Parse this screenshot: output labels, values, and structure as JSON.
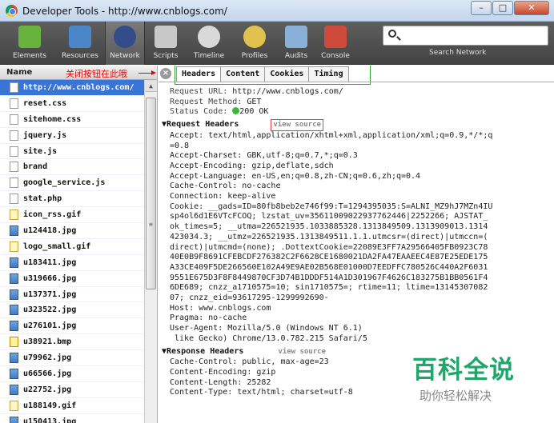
{
  "window": {
    "title": "Developer Tools - http://www.cnblogs.com/",
    "min_label": "–",
    "max_label": "□",
    "close_label": "✕"
  },
  "toolbar": {
    "tools": [
      {
        "label": "Elements",
        "color": "#68b33c"
      },
      {
        "label": "Resources",
        "color": "#4b86c9"
      },
      {
        "label": "Network",
        "color": "#334c8a"
      },
      {
        "label": "Scripts",
        "color": "#c8c8c8"
      },
      {
        "label": "Timeline",
        "color": "#d9d9d9"
      },
      {
        "label": "Profiles",
        "color": "#e2c24f"
      },
      {
        "label": "Audits",
        "color": "#8ab0d8"
      },
      {
        "label": "Console",
        "color": "#cf4a3b"
      }
    ],
    "search_label": "Search Network"
  },
  "left_pane": {
    "header": "Name",
    "annotation": "关闭按钮在此哦",
    "files": [
      {
        "name": "http://www.cnblogs.com/",
        "type": "doc"
      },
      {
        "name": "reset.css",
        "type": "doc"
      },
      {
        "name": "sitehome.css",
        "type": "doc"
      },
      {
        "name": "jquery.js",
        "type": "doc"
      },
      {
        "name": "site.js",
        "type": "doc"
      },
      {
        "name": "brand",
        "type": "doc"
      },
      {
        "name": "google_service.js",
        "type": "doc"
      },
      {
        "name": "stat.php",
        "type": "doc"
      },
      {
        "name": "icon_rss.gif",
        "type": "gif"
      },
      {
        "name": "u124418.jpg",
        "type": "img"
      },
      {
        "name": "logo_small.gif",
        "type": "gif"
      },
      {
        "name": "u183411.jpg",
        "type": "img"
      },
      {
        "name": "u319666.jpg",
        "type": "img"
      },
      {
        "name": "u137371.jpg",
        "type": "img"
      },
      {
        "name": "u323522.jpg",
        "type": "img"
      },
      {
        "name": "u276101.jpg",
        "type": "img"
      },
      {
        "name": "u38921.bmp",
        "type": "bmp"
      },
      {
        "name": "u79962.jpg",
        "type": "img"
      },
      {
        "name": "u66566.jpg",
        "type": "img"
      },
      {
        "name": "u22752.jpg",
        "type": "img"
      },
      {
        "name": "u188149.gif",
        "type": "gif"
      },
      {
        "name": "u150413.jpg",
        "type": "img"
      }
    ]
  },
  "right_pane": {
    "close_label": "×",
    "tabs": [
      "Headers",
      "Content",
      "Cookies",
      "Timing"
    ],
    "request_url": {
      "key": "Request URL:",
      "value": "http://www.cnblogs.com/"
    },
    "request_method": {
      "key": "Request Method:",
      "value": "GET"
    },
    "status_code": {
      "key": "Status Code:",
      "value": "200 OK"
    },
    "request_headers_title": "Request Headers",
    "view_source": "view source",
    "request_headers": [
      "Accept: text/html,application/xhtml+xml,application/xml;q=0.9,*/*;q",
      "=0.8",
      "Accept-Charset: GBK,utf-8;q=0.7,*;q=0.3",
      "Accept-Encoding: gzip,deflate,sdch",
      "Accept-Language: en-US,en;q=0.8,zh-CN;q=0.6,zh;q=0.4",
      "Cache-Control: no-cache",
      "Connection: keep-alive",
      "Cookie: __gads=ID=80fb8beb2e746f99:T=1294395035:S=ALNI_MZ9hJ7MZn4IU",
      "sp4ol6d1E6VTcFCOQ; lzstat_uv=35611009022937762446|2252266; AJSTAT_",
      "ok_times=5; __utma=226521935.1033885328.1313849509.1313909013.1314",
      "423034.3; __utmz=226521935.1313849511.1.1.utmcsr=(direct)|utmccn=(",
      "direct)|utmcmd=(none); .DottextCookie=22089E3FF7A29566405FB0923C78",
      "40E0B9F8691CFEBCDF276382C2F6628CE1680021DA2FA47EAAEEC4E87E25EDE175",
      "A33CE409F5DE266560E102A49E9AE02B568E01000D7EEDFFC780526C440A2F6031",
      "9551E675D3F8F8449870CF3D74B1DDDF514A1D301967F4626C183275B1BB0561F4",
      "6DE689; cnzz_a1710575=10; sin1710575=; rtime=11; ltime=13145307082",
      "07; cnzz_eid=93617295-1299992690-",
      "Host: www.cnblogs.com",
      "Pragma: no-cache",
      "User-Agent: Mozilla/5.0 (Windows NT 6.1)",
      " like Gecko) Chrome/13.0.782.215 Safari/5"
    ],
    "response_headers_title": "Response Headers",
    "response_headers": [
      "Cache-Control: public, max-age=23",
      "Content-Encoding: gzip",
      "Content-Length: 25282",
      "Content-Type: text/html; charset=utf-8"
    ]
  },
  "watermark": {
    "title": "百科全说",
    "subtitle": "助你轻松解决"
  }
}
